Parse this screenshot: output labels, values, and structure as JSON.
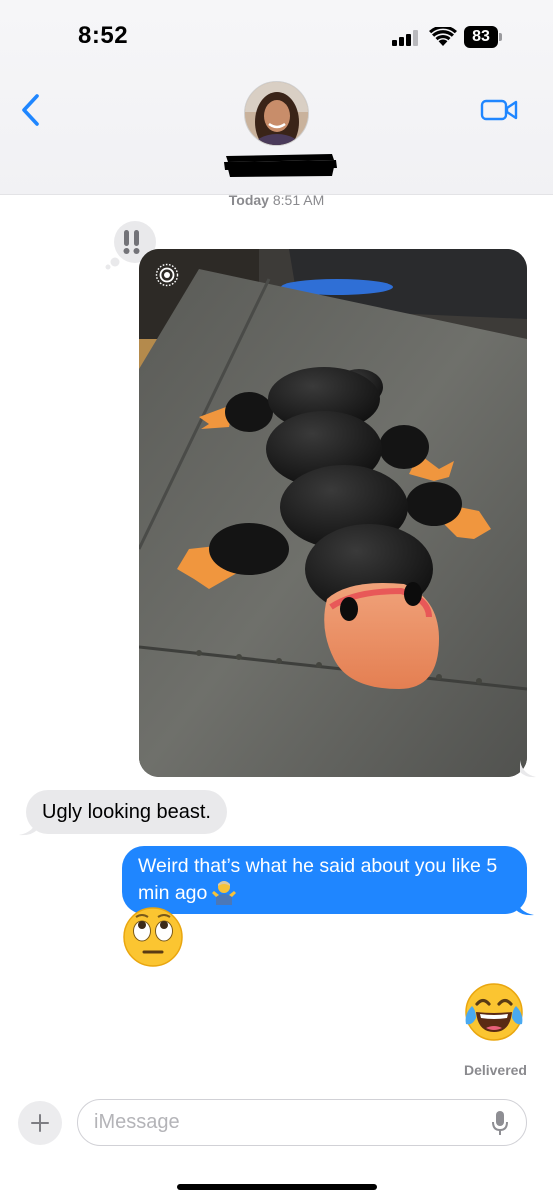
{
  "status_bar": {
    "time": "8:52",
    "battery_level": "83",
    "signal_bars": 3,
    "icons": [
      "cellular-signal-icon",
      "wifi-icon",
      "battery-icon"
    ]
  },
  "header": {
    "back_icon": "chevron-left-icon",
    "facetime_icon": "video-camera-icon",
    "contact_name_redacted": true,
    "accent_color": "#1f86ff"
  },
  "thread": {
    "timestamp_day": "Today",
    "timestamp_time": "8:51 AM",
    "tapback_icon": "double-exclamation-icon",
    "photo_live_icon": "live-photo-icon",
    "incoming_message": "Ugly looking beast.",
    "outgoing_message": "Weird that’s what he said about you like 5 min ago",
    "outgoing_emoji_icon": "person-shrugging-emoji",
    "reply_emoji_icon": "face-with-rolling-eyes-emoji",
    "sent_emoji_icon": "face-with-tears-of-joy-emoji",
    "delivery_status": "Delivered",
    "incoming_bubble_color": "#e9e9eb",
    "outgoing_bubble_color": "#1f86ff"
  },
  "composer": {
    "placeholder": "iMessage",
    "plus_icon": "plus-icon",
    "mic_icon": "microphone-icon"
  }
}
